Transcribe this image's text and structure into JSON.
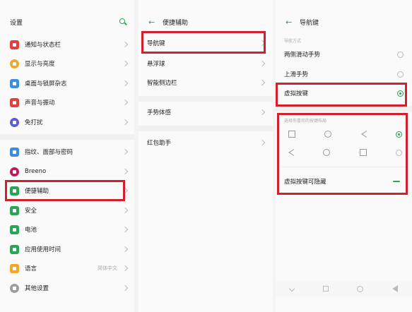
{
  "settings": {
    "title": "设置",
    "items": [
      {
        "label": "通知与状态栏",
        "value": "",
        "color": "#e2403f",
        "icon": "notification-icon"
      },
      {
        "label": "显示与亮度",
        "value": "",
        "color": "#f5a623",
        "icon": "brightness-icon"
      },
      {
        "label": "桌面与锁屏杂志",
        "value": "",
        "color": "#3b8de0",
        "icon": "wallpaper-icon"
      },
      {
        "label": "声音与振动",
        "value": "",
        "color": "#e2403f",
        "icon": "sound-icon"
      },
      {
        "label": "免打扰",
        "value": "",
        "color": "#5a5ed6",
        "icon": "moon-icon"
      },
      {
        "label": "指纹、面部与密码",
        "value": "",
        "color": "#3b8de0",
        "icon": "fingerprint-icon"
      },
      {
        "label": "Breeno",
        "value": "",
        "color": "#c2185b",
        "icon": "breeno-icon"
      },
      {
        "label": "便捷辅助",
        "value": "",
        "color": "#2aa456",
        "icon": "assist-icon"
      },
      {
        "label": "安全",
        "value": "",
        "color": "#2aa456",
        "icon": "shield-icon"
      },
      {
        "label": "电池",
        "value": "",
        "color": "#2aa456",
        "icon": "battery-icon"
      },
      {
        "label": "应用使用时间",
        "value": "",
        "color": "#2aa456",
        "icon": "hourglass-icon"
      },
      {
        "label": "语言",
        "value": "简体中文",
        "color": "#f5a623",
        "icon": "language-icon"
      },
      {
        "label": "其他设置",
        "value": "",
        "color": "#9e9e9e",
        "icon": "more-icon"
      }
    ]
  },
  "assist": {
    "title": "便捷辅助",
    "items": [
      {
        "label": "导航键"
      },
      {
        "label": "悬浮球"
      },
      {
        "label": "智能侧边栏"
      },
      {
        "label": "手势体感"
      },
      {
        "label": "红包助手"
      }
    ]
  },
  "navkeys": {
    "title": "导航键",
    "section_caption": "导航方式",
    "options": [
      {
        "label": "两侧滑动手势",
        "selected": false
      },
      {
        "label": "上滑手势",
        "selected": false
      },
      {
        "label": "虚拟按键",
        "selected": true
      }
    ],
    "layout_caption": "选择你喜欢的按键布局",
    "layouts": [
      {
        "shapes": [
          "square",
          "circle",
          "triangle"
        ],
        "selected": true
      },
      {
        "shapes": [
          "triangle",
          "circle",
          "square"
        ],
        "selected": false
      }
    ],
    "hide_toggle_label": "虚拟按键可隐藏",
    "hide_toggle_on": true
  },
  "accent_color": "#2aa456",
  "highlight_color": "#d3202c"
}
